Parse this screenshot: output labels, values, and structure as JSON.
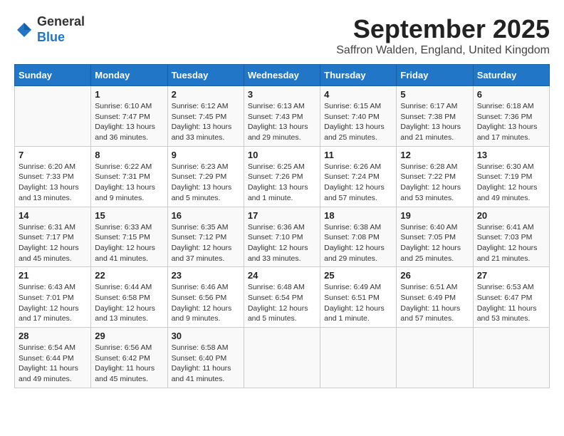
{
  "header": {
    "logo_line1": "General",
    "logo_line2": "Blue",
    "month": "September 2025",
    "location": "Saffron Walden, England, United Kingdom"
  },
  "weekdays": [
    "Sunday",
    "Monday",
    "Tuesday",
    "Wednesday",
    "Thursday",
    "Friday",
    "Saturday"
  ],
  "weeks": [
    [
      {
        "day": "",
        "sunrise": "",
        "sunset": "",
        "daylight": ""
      },
      {
        "day": "1",
        "sunrise": "Sunrise: 6:10 AM",
        "sunset": "Sunset: 7:47 PM",
        "daylight": "Daylight: 13 hours and 36 minutes."
      },
      {
        "day": "2",
        "sunrise": "Sunrise: 6:12 AM",
        "sunset": "Sunset: 7:45 PM",
        "daylight": "Daylight: 13 hours and 33 minutes."
      },
      {
        "day": "3",
        "sunrise": "Sunrise: 6:13 AM",
        "sunset": "Sunset: 7:43 PM",
        "daylight": "Daylight: 13 hours and 29 minutes."
      },
      {
        "day": "4",
        "sunrise": "Sunrise: 6:15 AM",
        "sunset": "Sunset: 7:40 PM",
        "daylight": "Daylight: 13 hours and 25 minutes."
      },
      {
        "day": "5",
        "sunrise": "Sunrise: 6:17 AM",
        "sunset": "Sunset: 7:38 PM",
        "daylight": "Daylight: 13 hours and 21 minutes."
      },
      {
        "day": "6",
        "sunrise": "Sunrise: 6:18 AM",
        "sunset": "Sunset: 7:36 PM",
        "daylight": "Daylight: 13 hours and 17 minutes."
      }
    ],
    [
      {
        "day": "7",
        "sunrise": "Sunrise: 6:20 AM",
        "sunset": "Sunset: 7:33 PM",
        "daylight": "Daylight: 13 hours and 13 minutes."
      },
      {
        "day": "8",
        "sunrise": "Sunrise: 6:22 AM",
        "sunset": "Sunset: 7:31 PM",
        "daylight": "Daylight: 13 hours and 9 minutes."
      },
      {
        "day": "9",
        "sunrise": "Sunrise: 6:23 AM",
        "sunset": "Sunset: 7:29 PM",
        "daylight": "Daylight: 13 hours and 5 minutes."
      },
      {
        "day": "10",
        "sunrise": "Sunrise: 6:25 AM",
        "sunset": "Sunset: 7:26 PM",
        "daylight": "Daylight: 13 hours and 1 minute."
      },
      {
        "day": "11",
        "sunrise": "Sunrise: 6:26 AM",
        "sunset": "Sunset: 7:24 PM",
        "daylight": "Daylight: 12 hours and 57 minutes."
      },
      {
        "day": "12",
        "sunrise": "Sunrise: 6:28 AM",
        "sunset": "Sunset: 7:22 PM",
        "daylight": "Daylight: 12 hours and 53 minutes."
      },
      {
        "day": "13",
        "sunrise": "Sunrise: 6:30 AM",
        "sunset": "Sunset: 7:19 PM",
        "daylight": "Daylight: 12 hours and 49 minutes."
      }
    ],
    [
      {
        "day": "14",
        "sunrise": "Sunrise: 6:31 AM",
        "sunset": "Sunset: 7:17 PM",
        "daylight": "Daylight: 12 hours and 45 minutes."
      },
      {
        "day": "15",
        "sunrise": "Sunrise: 6:33 AM",
        "sunset": "Sunset: 7:15 PM",
        "daylight": "Daylight: 12 hours and 41 minutes."
      },
      {
        "day": "16",
        "sunrise": "Sunrise: 6:35 AM",
        "sunset": "Sunset: 7:12 PM",
        "daylight": "Daylight: 12 hours and 37 minutes."
      },
      {
        "day": "17",
        "sunrise": "Sunrise: 6:36 AM",
        "sunset": "Sunset: 7:10 PM",
        "daylight": "Daylight: 12 hours and 33 minutes."
      },
      {
        "day": "18",
        "sunrise": "Sunrise: 6:38 AM",
        "sunset": "Sunset: 7:08 PM",
        "daylight": "Daylight: 12 hours and 29 minutes."
      },
      {
        "day": "19",
        "sunrise": "Sunrise: 6:40 AM",
        "sunset": "Sunset: 7:05 PM",
        "daylight": "Daylight: 12 hours and 25 minutes."
      },
      {
        "day": "20",
        "sunrise": "Sunrise: 6:41 AM",
        "sunset": "Sunset: 7:03 PM",
        "daylight": "Daylight: 12 hours and 21 minutes."
      }
    ],
    [
      {
        "day": "21",
        "sunrise": "Sunrise: 6:43 AM",
        "sunset": "Sunset: 7:01 PM",
        "daylight": "Daylight: 12 hours and 17 minutes."
      },
      {
        "day": "22",
        "sunrise": "Sunrise: 6:44 AM",
        "sunset": "Sunset: 6:58 PM",
        "daylight": "Daylight: 12 hours and 13 minutes."
      },
      {
        "day": "23",
        "sunrise": "Sunrise: 6:46 AM",
        "sunset": "Sunset: 6:56 PM",
        "daylight": "Daylight: 12 hours and 9 minutes."
      },
      {
        "day": "24",
        "sunrise": "Sunrise: 6:48 AM",
        "sunset": "Sunset: 6:54 PM",
        "daylight": "Daylight: 12 hours and 5 minutes."
      },
      {
        "day": "25",
        "sunrise": "Sunrise: 6:49 AM",
        "sunset": "Sunset: 6:51 PM",
        "daylight": "Daylight: 12 hours and 1 minute."
      },
      {
        "day": "26",
        "sunrise": "Sunrise: 6:51 AM",
        "sunset": "Sunset: 6:49 PM",
        "daylight": "Daylight: 11 hours and 57 minutes."
      },
      {
        "day": "27",
        "sunrise": "Sunrise: 6:53 AM",
        "sunset": "Sunset: 6:47 PM",
        "daylight": "Daylight: 11 hours and 53 minutes."
      }
    ],
    [
      {
        "day": "28",
        "sunrise": "Sunrise: 6:54 AM",
        "sunset": "Sunset: 6:44 PM",
        "daylight": "Daylight: 11 hours and 49 minutes."
      },
      {
        "day": "29",
        "sunrise": "Sunrise: 6:56 AM",
        "sunset": "Sunset: 6:42 PM",
        "daylight": "Daylight: 11 hours and 45 minutes."
      },
      {
        "day": "30",
        "sunrise": "Sunrise: 6:58 AM",
        "sunset": "Sunset: 6:40 PM",
        "daylight": "Daylight: 11 hours and 41 minutes."
      },
      {
        "day": "",
        "sunrise": "",
        "sunset": "",
        "daylight": ""
      },
      {
        "day": "",
        "sunrise": "",
        "sunset": "",
        "daylight": ""
      },
      {
        "day": "",
        "sunrise": "",
        "sunset": "",
        "daylight": ""
      },
      {
        "day": "",
        "sunrise": "",
        "sunset": "",
        "daylight": ""
      }
    ]
  ]
}
